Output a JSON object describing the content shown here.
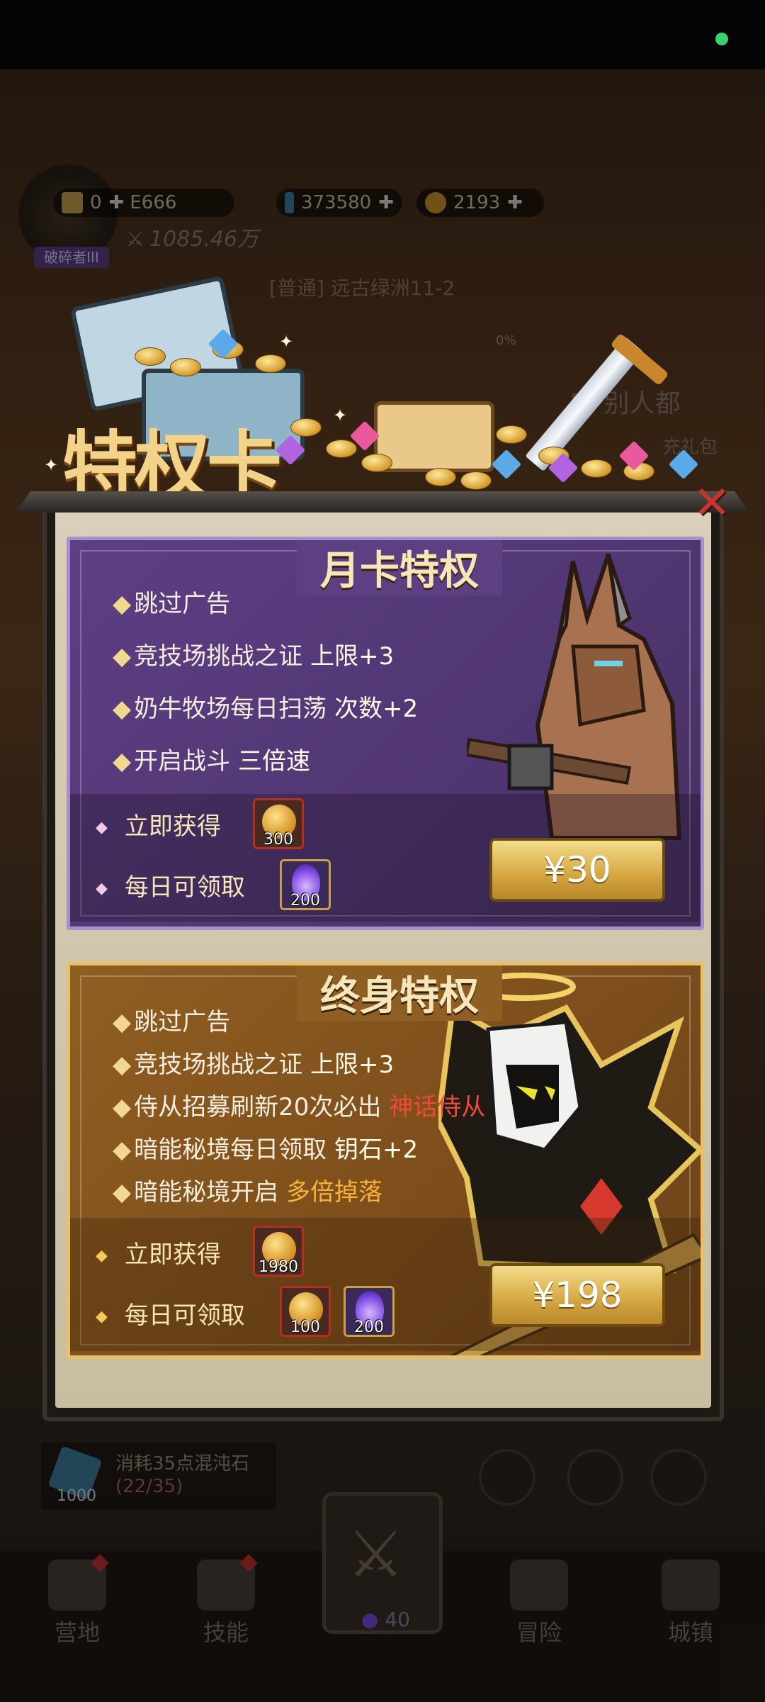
{
  "hud": {
    "ticket_count": "0",
    "ticket_suffix": "E666",
    "rank_badge": "破碎者III",
    "crystal_count": "373580",
    "coin_count": "2193",
    "power": "1085.46万",
    "stage_title": "[普通] 远古绿洲11-2",
    "stage_progress": "0%",
    "side_text": "安 别人都",
    "side_subtext": "充礼包"
  },
  "popup": {
    "banner_title": "特权卡",
    "close_symbol": "✕"
  },
  "monthly_card": {
    "title": "月卡特权",
    "perks": [
      {
        "text": "跳过广告",
        "highlight": ""
      },
      {
        "text": "竞技场挑战之证 ",
        "highlight": "上限+3"
      },
      {
        "text": "奶牛牧场每日扫荡 ",
        "highlight": "次数+2"
      },
      {
        "text": "开启战斗 ",
        "highlight": "三倍速"
      }
    ],
    "instant_label": "立即获得",
    "instant_item_qty": "300",
    "daily_label": "每日可领取",
    "daily_item_qty": "200",
    "price": "¥30"
  },
  "lifetime_card": {
    "title": "终身特权",
    "perks": [
      {
        "text": "跳过广告",
        "highlight": ""
      },
      {
        "text": "竞技场挑战之证 ",
        "highlight": "上限+3"
      },
      {
        "text": "侍从招募刷新20次必出 ",
        "highlight": "神话侍从"
      },
      {
        "text": "暗能秘境每日领取 ",
        "highlight": "钥石+2"
      },
      {
        "text": "暗能秘境开启 ",
        "highlight": "多倍掉落"
      }
    ],
    "instant_label": "立即获得",
    "instant_item_qty": "1980",
    "daily_label": "每日可领取",
    "daily_item_qty_1": "100",
    "daily_item_qty_2": "200",
    "price": "¥198"
  },
  "cost_panel": {
    "crystal_qty": "1000",
    "text": "消耗35点混沌石",
    "progress": "(22/35)"
  },
  "nav": {
    "items": [
      "营地",
      "技能",
      "冒险",
      "城镇"
    ],
    "center_count": "40"
  },
  "colors": {
    "monthly_bg": "#5d3f84",
    "lifetime_bg": "#8f5e22",
    "highlight_red": "#ef4b3a",
    "price_gold": "#d4a640"
  }
}
